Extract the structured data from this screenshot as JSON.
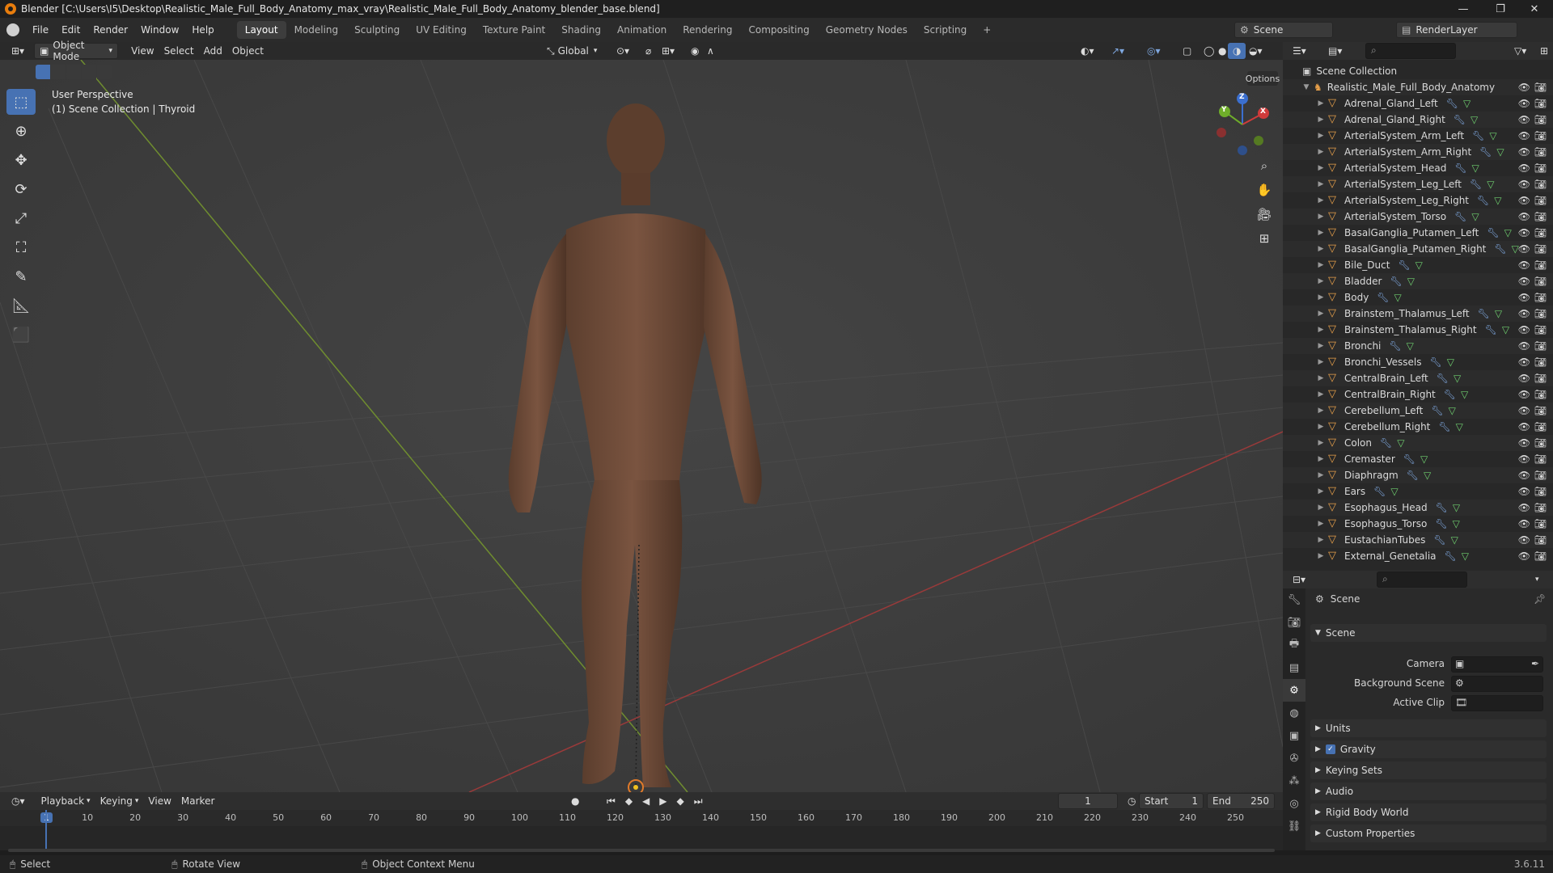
{
  "window": {
    "title": "Blender [C:\\Users\\I5\\Desktop\\Realistic_Male_Full_Body_Anatomy_max_vray\\Realistic_Male_Full_Body_Anatomy_blender_base.blend]",
    "minimize": "—",
    "maximize": "❐",
    "close": "✕"
  },
  "menu": {
    "items": [
      "File",
      "Edit",
      "Render",
      "Window",
      "Help"
    ],
    "workspaces": [
      "Layout",
      "Modeling",
      "Sculpting",
      "UV Editing",
      "Texture Paint",
      "Shading",
      "Animation",
      "Rendering",
      "Compositing",
      "Geometry Nodes",
      "Scripting"
    ],
    "active_workspace": "Layout",
    "add_workspace": "+",
    "scene_label": "Scene",
    "renderlayer_label": "RenderLayer"
  },
  "viewport_header": {
    "mode": "Object Mode",
    "menus": [
      "View",
      "Select",
      "Add",
      "Object"
    ],
    "orientation": "Global",
    "options": "Options"
  },
  "viewport": {
    "perspective": "User Perspective",
    "context": "(1) Scene Collection | Thyroid",
    "gizmo_z": "Z",
    "gizmo_y": "Y",
    "gizmo_x": "X"
  },
  "outliner": {
    "root": "Scene Collection",
    "collection": "Realistic_Male_Full_Body_Anatomy",
    "items": [
      "Adrenal_Gland_Left",
      "Adrenal_Gland_Right",
      "ArterialSystem_Arm_Left",
      "ArterialSystem_Arm_Right",
      "ArterialSystem_Head",
      "ArterialSystem_Leg_Left",
      "ArterialSystem_Leg_Right",
      "ArterialSystem_Torso",
      "BasalGanglia_Putamen_Left",
      "BasalGanglia_Putamen_Right",
      "Bile_Duct",
      "Bladder",
      "Body",
      "Brainstem_Thalamus_Left",
      "Brainstem_Thalamus_Right",
      "Bronchi",
      "Bronchi_Vessels",
      "CentralBrain_Left",
      "CentralBrain_Right",
      "Cerebellum_Left",
      "Cerebellum_Right",
      "Colon",
      "Cremaster",
      "Diaphragm",
      "Ears",
      "Esophagus_Head",
      "Esophagus_Torso",
      "EustachianTubes",
      "External_Genetalia"
    ]
  },
  "properties": {
    "context": "Scene",
    "section_scene": "Scene",
    "camera_label": "Camera",
    "background_label": "Background Scene",
    "clip_label": "Active Clip",
    "collapsed": [
      "Units",
      "Gravity",
      "Keying Sets",
      "Audio",
      "Rigid Body World",
      "Custom Properties"
    ],
    "gravity_checked": true
  },
  "timeline": {
    "menus": [
      "Playback",
      "Keying",
      "View",
      "Marker"
    ],
    "current_frame": "1",
    "start_label": "Start",
    "start_value": "1",
    "end_label": "End",
    "end_value": "250",
    "ticks": [
      "1",
      "10",
      "20",
      "30",
      "40",
      "50",
      "60",
      "70",
      "80",
      "90",
      "100",
      "110",
      "120",
      "130",
      "140",
      "150",
      "160",
      "170",
      "180",
      "190",
      "200",
      "210",
      "220",
      "230",
      "240",
      "250"
    ]
  },
  "status": {
    "select": "Select",
    "rotate": "Rotate View",
    "context_menu": "Object Context Menu",
    "version": "3.6.11"
  }
}
